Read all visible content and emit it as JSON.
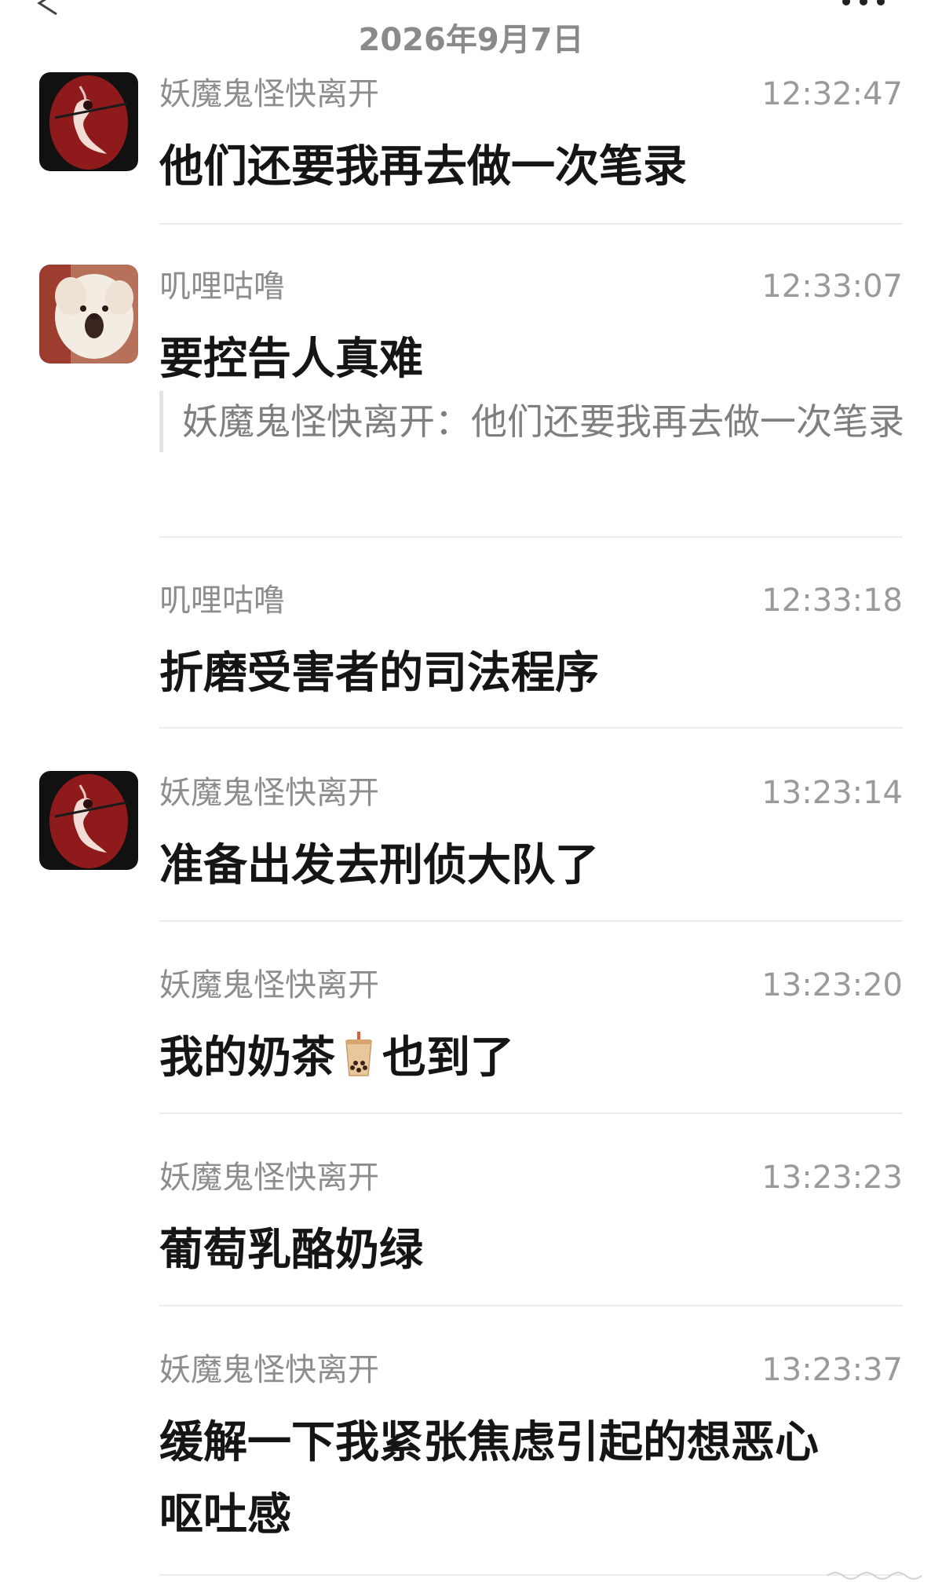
{
  "header": {
    "date": "2026年9月7日",
    "back_icon": "chevron-left-icon",
    "more_icon": "more-dots-icon"
  },
  "messages": [
    {
      "sender": "妖魔鬼怪快离开",
      "time": "12:32:47",
      "text": "他们还要我再去做一次笔录",
      "avatar": "ink-painting-avatar"
    },
    {
      "sender": "叽哩咕噜",
      "time": "12:33:07",
      "text": "要控告人真难",
      "quote": "妖魔鬼怪快离开：他们还要我再去做一次笔录",
      "avatar": "dog-avatar"
    },
    {
      "sender": "叽哩咕噜",
      "time": "12:33:18",
      "text": "折磨受害者的司法程序"
    },
    {
      "sender": "妖魔鬼怪快离开",
      "time": "13:23:14",
      "text": "准备出发去刑侦大队了",
      "avatar": "ink-painting-avatar"
    },
    {
      "sender": "妖魔鬼怪快离开",
      "time": "13:23:20",
      "text_before": "我的奶茶",
      "emoji": "bubble-tea-icon",
      "text_after": "也到了"
    },
    {
      "sender": "妖魔鬼怪快离开",
      "time": "13:23:23",
      "text": "葡萄乳酪奶绿"
    },
    {
      "sender": "妖魔鬼怪快离开",
      "time": "13:23:37",
      "text": "缓解一下我紧张焦虑引起的想恶心呕吐感"
    }
  ],
  "colors": {
    "sender": "#8d8d8d",
    "time": "#9a9a9a",
    "text": "#151515",
    "divider": "#ececec",
    "avatar_red": "#8e1a1c"
  }
}
